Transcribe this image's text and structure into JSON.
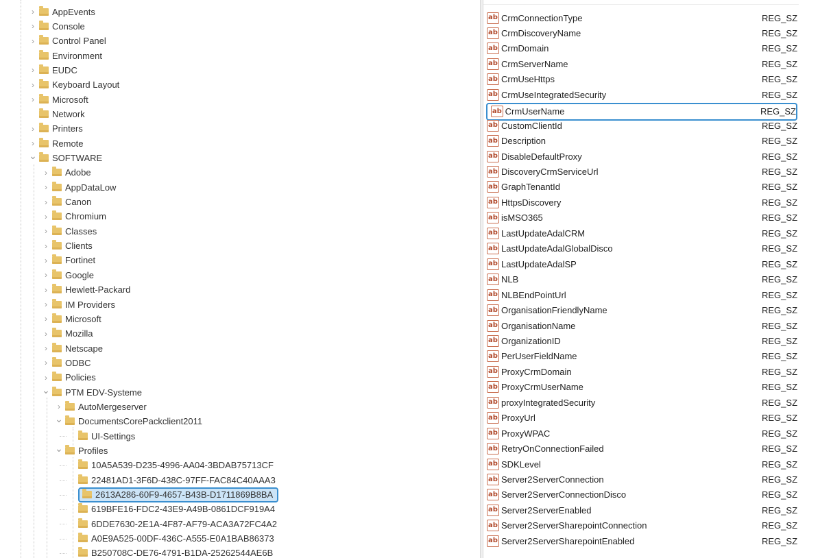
{
  "tree": {
    "items": [
      {
        "label": "AppEvents",
        "level": 0,
        "expander": "collapsed"
      },
      {
        "label": "Console",
        "level": 0,
        "expander": "collapsed"
      },
      {
        "label": "Control Panel",
        "level": 0,
        "expander": "collapsed"
      },
      {
        "label": "Environment",
        "level": 0,
        "expander": "none"
      },
      {
        "label": "EUDC",
        "level": 0,
        "expander": "collapsed"
      },
      {
        "label": "Keyboard Layout",
        "level": 0,
        "expander": "collapsed"
      },
      {
        "label": "Microsoft",
        "level": 0,
        "expander": "collapsed"
      },
      {
        "label": "Network",
        "level": 0,
        "expander": "none"
      },
      {
        "label": "Printers",
        "level": 0,
        "expander": "collapsed"
      },
      {
        "label": "Remote",
        "level": 0,
        "expander": "collapsed"
      },
      {
        "label": "SOFTWARE",
        "level": 0,
        "expander": "expanded"
      },
      {
        "label": "Adobe",
        "level": 1,
        "expander": "collapsed"
      },
      {
        "label": "AppDataLow",
        "level": 1,
        "expander": "collapsed"
      },
      {
        "label": "Canon",
        "level": 1,
        "expander": "collapsed"
      },
      {
        "label": "Chromium",
        "level": 1,
        "expander": "collapsed"
      },
      {
        "label": "Classes",
        "level": 1,
        "expander": "collapsed"
      },
      {
        "label": "Clients",
        "level": 1,
        "expander": "collapsed"
      },
      {
        "label": "Fortinet",
        "level": 1,
        "expander": "collapsed"
      },
      {
        "label": "Google",
        "level": 1,
        "expander": "collapsed"
      },
      {
        "label": "Hewlett-Packard",
        "level": 1,
        "expander": "collapsed"
      },
      {
        "label": "IM Providers",
        "level": 1,
        "expander": "collapsed"
      },
      {
        "label": "Microsoft",
        "level": 1,
        "expander": "collapsed"
      },
      {
        "label": "Mozilla",
        "level": 1,
        "expander": "collapsed"
      },
      {
        "label": "Netscape",
        "level": 1,
        "expander": "collapsed"
      },
      {
        "label": "ODBC",
        "level": 1,
        "expander": "collapsed"
      },
      {
        "label": "Policies",
        "level": 1,
        "expander": "collapsed"
      },
      {
        "label": "PTM EDV-Systeme",
        "level": 1,
        "expander": "expanded"
      },
      {
        "label": "AutoMergeserver",
        "level": 2,
        "expander": "collapsed"
      },
      {
        "label": "DocumentsCorePackclient2011",
        "level": 2,
        "expander": "expanded"
      },
      {
        "label": "UI-Settings",
        "level": 3,
        "expander": "none"
      },
      {
        "label": "Profiles",
        "level": 2,
        "expander": "expanded"
      },
      {
        "label": "10A5A539-D235-4996-AA04-3BDAB75713CF",
        "level": 3,
        "expander": "none"
      },
      {
        "label": "22481AD1-3F6D-438C-97FF-FAC84C40AAA3",
        "level": 3,
        "expander": "none"
      },
      {
        "label": "2613A286-60F9-4657-B43B-D1711869B8BA",
        "level": 3,
        "expander": "none",
        "selected": true
      },
      {
        "label": "619BFE16-FDC2-43E9-A49B-0861DCF919A4",
        "level": 3,
        "expander": "none"
      },
      {
        "label": "6DDE7630-2E1A-4F87-AF79-ACA3A72FC4A2",
        "level": 3,
        "expander": "none"
      },
      {
        "label": "A0E9A525-00DF-436C-A555-E0A1BAB86373",
        "level": 3,
        "expander": "none"
      },
      {
        "label": "B250708C-DE76-4791-B1DA-25262544AE6B",
        "level": 3,
        "expander": "none"
      }
    ]
  },
  "values": {
    "icon_text": "ab",
    "rows": [
      {
        "name": "CrmConnectionType",
        "type": "REG_SZ"
      },
      {
        "name": "CrmDiscoveryName",
        "type": "REG_SZ"
      },
      {
        "name": "CrmDomain",
        "type": "REG_SZ"
      },
      {
        "name": "CrmServerName",
        "type": "REG_SZ"
      },
      {
        "name": "CrmUseHttps",
        "type": "REG_SZ"
      },
      {
        "name": "CrmUseIntegratedSecurity",
        "type": "REG_SZ"
      },
      {
        "name": "CrmUserName",
        "type": "REG_SZ",
        "selected": true
      },
      {
        "name": "CustomClientId",
        "type": "REG_SZ"
      },
      {
        "name": "Description",
        "type": "REG_SZ"
      },
      {
        "name": "DisableDefaultProxy",
        "type": "REG_SZ"
      },
      {
        "name": "DiscoveryCrmServiceUrl",
        "type": "REG_SZ"
      },
      {
        "name": "GraphTenantId",
        "type": "REG_SZ"
      },
      {
        "name": "HttpsDiscovery",
        "type": "REG_SZ"
      },
      {
        "name": "isMSO365",
        "type": "REG_SZ"
      },
      {
        "name": "LastUpdateAdalCRM",
        "type": "REG_SZ"
      },
      {
        "name": "LastUpdateAdalGlobalDisco",
        "type": "REG_SZ"
      },
      {
        "name": "LastUpdateAdalSP",
        "type": "REG_SZ"
      },
      {
        "name": "NLB",
        "type": "REG_SZ"
      },
      {
        "name": "NLBEndPointUrl",
        "type": "REG_SZ"
      },
      {
        "name": "OrganisationFriendlyName",
        "type": "REG_SZ"
      },
      {
        "name": "OrganisationName",
        "type": "REG_SZ"
      },
      {
        "name": "OrganizationID",
        "type": "REG_SZ"
      },
      {
        "name": "PerUserFieldName",
        "type": "REG_SZ"
      },
      {
        "name": "ProxyCrmDomain",
        "type": "REG_SZ"
      },
      {
        "name": "ProxyCrmUserName",
        "type": "REG_SZ"
      },
      {
        "name": "proxyIntegratedSecurity",
        "type": "REG_SZ"
      },
      {
        "name": "ProxyUrl",
        "type": "REG_SZ"
      },
      {
        "name": "ProxyWPAC",
        "type": "REG_SZ"
      },
      {
        "name": "RetryOnConnectionFailed",
        "type": "REG_SZ"
      },
      {
        "name": "SDKLevel",
        "type": "REG_SZ"
      },
      {
        "name": "Server2ServerConnection",
        "type": "REG_SZ"
      },
      {
        "name": "Server2ServerConnectionDisco",
        "type": "REG_SZ"
      },
      {
        "name": "Server2ServerEnabled",
        "type": "REG_SZ"
      },
      {
        "name": "Server2ServerSharepointConnection",
        "type": "REG_SZ"
      },
      {
        "name": "Server2ServerSharepointEnabled",
        "type": "REG_SZ"
      }
    ]
  },
  "colors": {
    "selection_border": "#3a8fd0",
    "selection_fill": "#cce4f7",
    "folder": "#e8c46a",
    "value_icon": "#b14a2c"
  }
}
